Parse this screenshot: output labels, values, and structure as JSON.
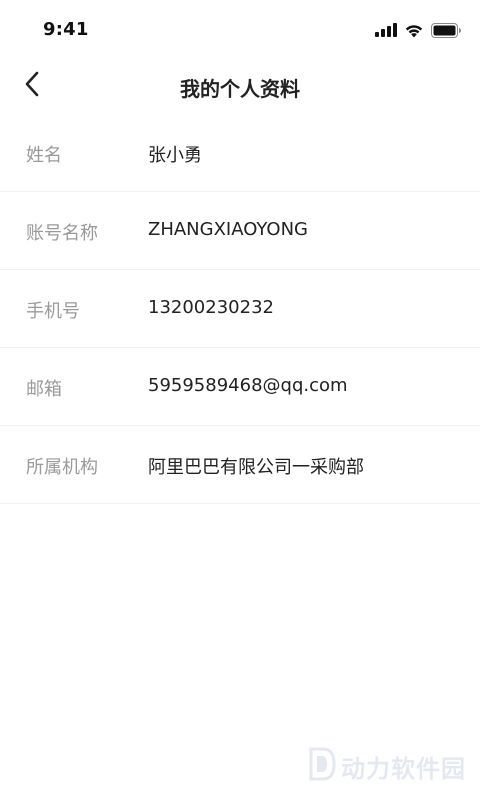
{
  "status_bar": {
    "time": "9:41"
  },
  "nav": {
    "title": "我的个人资料"
  },
  "profile": {
    "rows": [
      {
        "label": "姓名",
        "value": "张小勇"
      },
      {
        "label": "账号名称",
        "value": "ZHANGXIAOYONG"
      },
      {
        "label": "手机号",
        "value": "13200230232"
      },
      {
        "label": "邮箱",
        "value": "5959589468@qq.com"
      },
      {
        "label": "所属机构",
        "value": "阿里巴巴有限公司一采购部"
      }
    ]
  },
  "watermark": {
    "text": "动力软件园"
  },
  "icons": {
    "back": "chevron-left-icon",
    "signal": "cellular-signal-icon",
    "wifi": "wifi-icon",
    "battery": "battery-icon"
  }
}
